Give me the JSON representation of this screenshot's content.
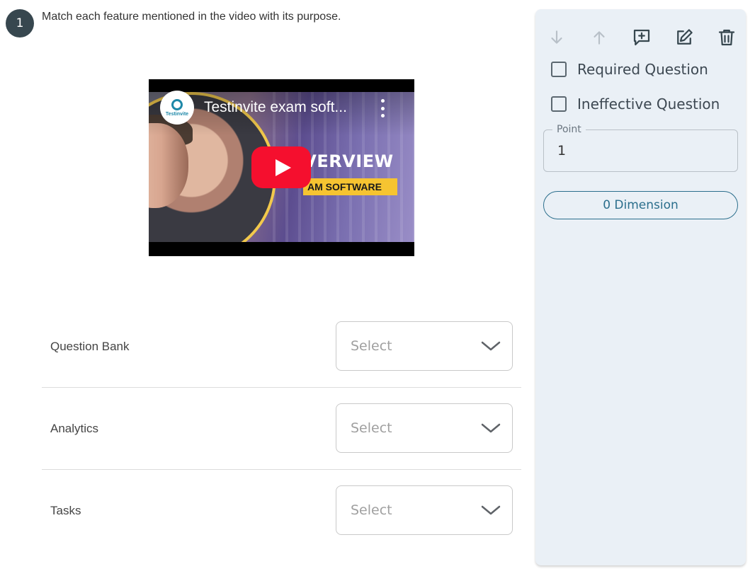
{
  "question": {
    "number": "1",
    "text": "Match each feature mentioned in the video with its purpose."
  },
  "video": {
    "title": "Testinvite exam soft...",
    "channel_name": "Testinvite",
    "overlay_heading": "OVERVIEW",
    "overlay_tag": "AM SOFTWARE",
    "icons": [
      "play-icon",
      "more-vert-icon"
    ]
  },
  "matches": [
    {
      "label": "Question Bank",
      "placeholder": "Select"
    },
    {
      "label": "Analytics",
      "placeholder": "Select"
    },
    {
      "label": "Tasks",
      "placeholder": "Select"
    }
  ],
  "side_panel": {
    "toolbar_icons": [
      "arrow-down-icon",
      "arrow-up-icon",
      "add-comment-icon",
      "edit-icon",
      "delete-icon"
    ],
    "required_label": "Required Question",
    "required_checked": false,
    "ineffective_label": "Ineffective Question",
    "ineffective_checked": false,
    "point_label": "Point",
    "point_value": "1",
    "dimension_label": "0 Dimension"
  },
  "colors": {
    "badge": "#37474f",
    "panel_bg": "#eaf0f6",
    "accent": "#2b6e8c",
    "youtube_red": "#f50f2e"
  }
}
